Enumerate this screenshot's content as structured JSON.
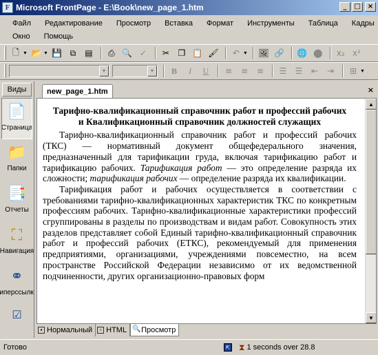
{
  "window": {
    "title": "Microsoft FrontPage - E:\\Book\\new_page_1.htm",
    "app_icon": "frontpage-icon",
    "controls": [
      "_",
      "□",
      "×"
    ]
  },
  "menu": {
    "items": [
      "Файл",
      "Редактирование",
      "Просмотр",
      "Вставка",
      "Формат",
      "Инструменты",
      "Таблица",
      "Кадры",
      "Окно",
      "Помощь"
    ]
  },
  "toolbar_icons": [
    "new-page-icon",
    "open-icon",
    "save-icon",
    "publish-icon",
    "folder-list-icon",
    "print-icon",
    "print-preview-icon",
    "spelling-icon",
    "cut-icon",
    "copy-icon",
    "paste-icon",
    "format-painter-icon",
    "undo-icon",
    "image-icon",
    "hyperlink-icon",
    "refresh-icon",
    "subscript-icon",
    "superscript-icon"
  ],
  "format_toolbar": {
    "bold": "B",
    "italic": "I",
    "underline": "U"
  },
  "views": {
    "header": "Виды",
    "items": [
      {
        "label": "Страница",
        "icon": "page-view-icon"
      },
      {
        "label": "Папки",
        "icon": "folders-icon"
      },
      {
        "label": "Отчеты",
        "icon": "reports-icon"
      },
      {
        "label": "Навигация",
        "icon": "navigation-icon"
      },
      {
        "label": "Гиперссылки",
        "icon": "hyperlinks-icon"
      },
      {
        "label": "Задачи",
        "icon": "tasks-icon"
      }
    ]
  },
  "editor": {
    "tab_label": "new_page_1.htm",
    "heading": "Тарифно-квалификационный справочник работ и профессий рабочих и Квалификационный справочник должностей служащих",
    "p1_a": "Тарифно-квалификационный справочник работ и профессий рабочих (ТКС) — нормативный документ общефедерального значения, предназначенный для тарификации груда, включая тарификацию работ и тарификацию рабочих.",
    "p1_em1": "Тарификация работ",
    "p1_b": " — это определение разряда их сложности;",
    "p1_em2": "тарификация рабочих",
    "p1_c": " — определение разряда их квалификации.",
    "p2": "Тарификация работ и рабочих осуществляется в соответствии с требованиями тарифно-квалификационных характеристик ТКС по конкретным профессиям рабочих. Тарифно-квалификационные характеристики профессий сгруппированы в разделы по производствам и видам работ. Совокупность этих разделов представляет собой Единый тарифно-квалификационный справочник работ и профессий рабочих (ЕТКС), рекомендуемый для применения предприятиями, организациями, учреждениями повсеместно, на всем пространстве Российской Федерации независимо от их ведомственной подчиненности, других организационно-правовых форм"
  },
  "view_tabs": [
    "Нормальный",
    "HTML",
    "Просмотр"
  ],
  "status": {
    "text": "Готово",
    "speed": "1 seconds over 28.8"
  }
}
